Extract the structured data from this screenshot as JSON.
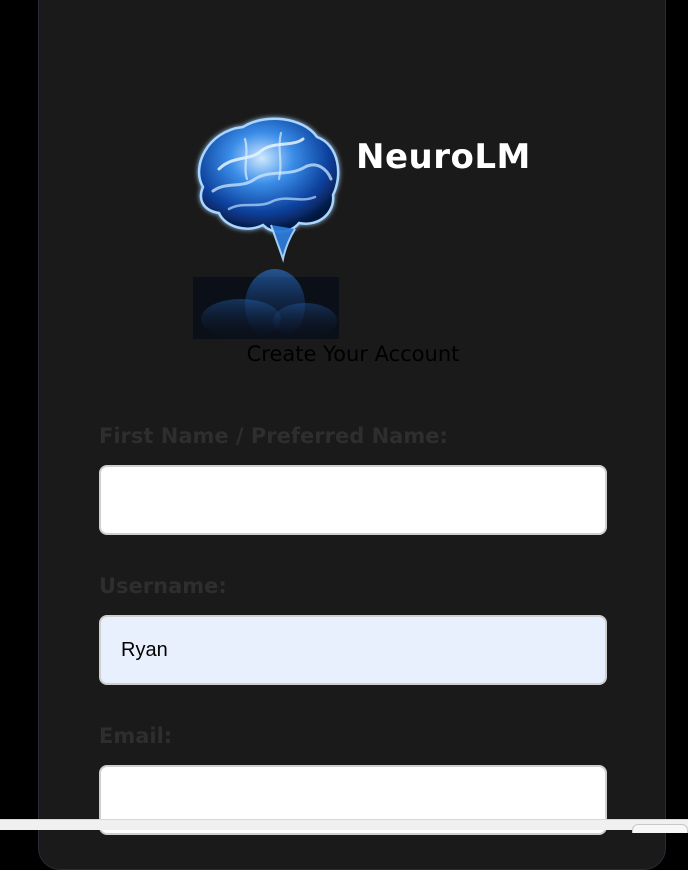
{
  "brand": {
    "name": "NeuroLM",
    "logo_icon": "brain-icon"
  },
  "form": {
    "subtitle": "Create Your Account",
    "fields": [
      {
        "label": "First Name / Preferred Name:",
        "value": "",
        "placeholder": ""
      },
      {
        "label": "Username:",
        "value": "Ryan",
        "placeholder": ""
      },
      {
        "label": "Email:",
        "value": "",
        "placeholder": ""
      }
    ]
  },
  "colors": {
    "page_background": "#000000",
    "card_background": "#1a1a1a",
    "autofill_background": "#e8f0fe",
    "brand_text": "#ffffff"
  }
}
